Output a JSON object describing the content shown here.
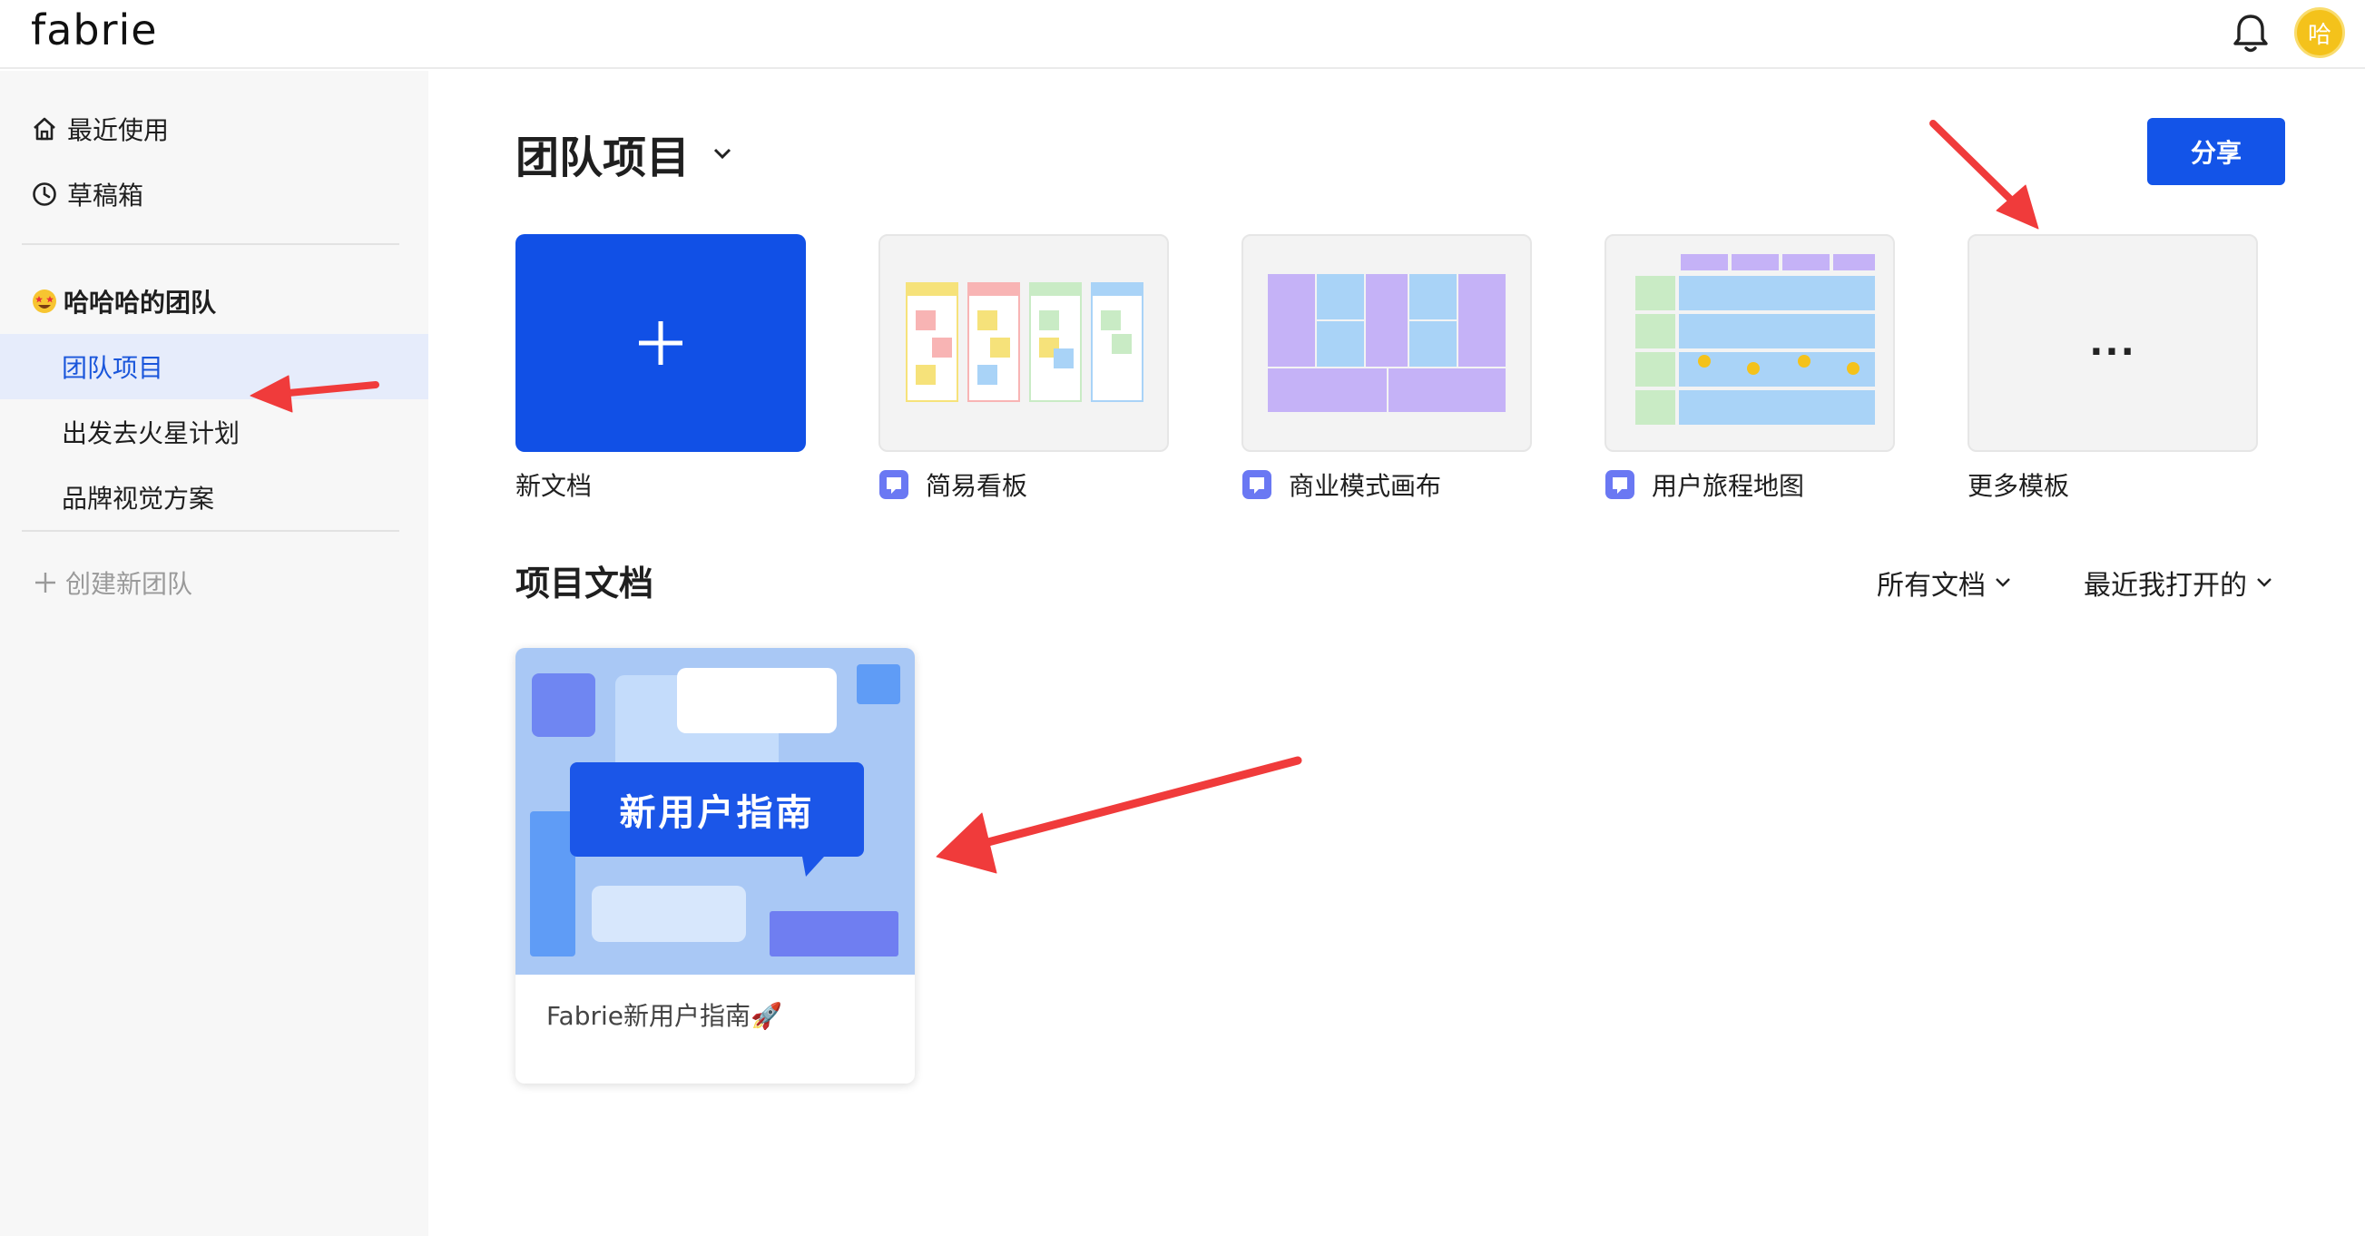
{
  "app": {
    "logo": "fabrie",
    "avatar_text": "哈",
    "colors": {
      "accent": "#1354e8",
      "annotation_arrow": "#f03b3b"
    }
  },
  "sidebar": {
    "items": [
      {
        "label": "最近使用",
        "icon": "home-icon"
      },
      {
        "label": "草稿箱",
        "icon": "clock-icon"
      }
    ],
    "team": {
      "name": "哈哈哈的团队",
      "emoji": "star-struck-emoji"
    },
    "projects": [
      {
        "label": "团队项目",
        "active": true
      },
      {
        "label": "出发去火星计划",
        "active": false
      },
      {
        "label": "品牌视觉方案",
        "active": false
      }
    ],
    "create_team": "创建新团队"
  },
  "main": {
    "title": "团队项目",
    "share_label": "分享",
    "templates": [
      {
        "label": "新文档"
      },
      {
        "label": "简易看板",
        "icon": "whiteboard-icon"
      },
      {
        "label": "商业模式画布",
        "icon": "whiteboard-icon"
      },
      {
        "label": "用户旅程地图",
        "icon": "whiteboard-icon"
      },
      {
        "label": "更多模板",
        "thumb_text": "..."
      }
    ],
    "docs_section_title": "项目文档",
    "filters": {
      "docs": "所有文档",
      "sort": "最近我打开的"
    },
    "docs": [
      {
        "cover_title": "新用户指南",
        "name": "Fabrie新用户指南🚀"
      }
    ]
  }
}
